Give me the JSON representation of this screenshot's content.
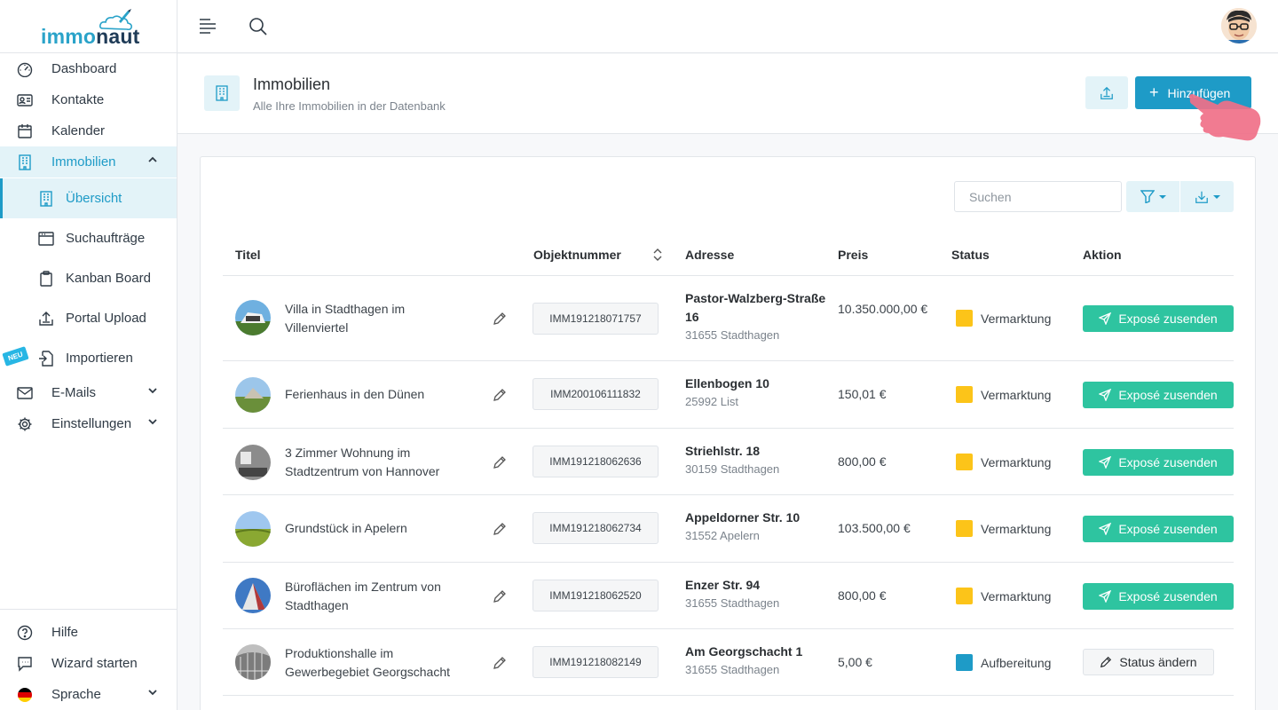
{
  "logo": {
    "part1": "immo",
    "part2": "naut"
  },
  "sidebar": {
    "items": [
      {
        "label": "Dashboard"
      },
      {
        "label": "Kontakte"
      },
      {
        "label": "Kalender"
      },
      {
        "label": "Immobilien"
      },
      {
        "label": "Übersicht"
      },
      {
        "label": "Suchaufträge"
      },
      {
        "label": "Kanban Board"
      },
      {
        "label": "Portal Upload"
      },
      {
        "label": "Importieren"
      },
      {
        "label": "E-Mails"
      },
      {
        "label": "Einstellungen"
      }
    ],
    "badge": "NEU",
    "bottom": [
      {
        "label": "Hilfe"
      },
      {
        "label": "Wizard starten"
      },
      {
        "label": "Sprache"
      }
    ]
  },
  "header": {
    "title": "Immobilien",
    "subtitle": "Alle Ihre Immobilien in der Datenbank",
    "add_label": "Hinzufügen"
  },
  "toolbar": {
    "search_placeholder": "Suchen"
  },
  "table": {
    "columns": [
      "Titel",
      "Objektnummer",
      "Adresse",
      "Preis",
      "Status",
      "Aktion"
    ],
    "rows": [
      {
        "title": "Villa in Stadthagen im Villenviertel",
        "objnr": "IMM191218071757",
        "street": "Pastor-Walzberg-Straße 16",
        "city": "31655 Stadthagen",
        "price": "10.350.000,00 €",
        "status": "Vermarktung",
        "action": "Exposé zusenden"
      },
      {
        "title": "Ferienhaus in den Dünen",
        "objnr": "IMM200106111832",
        "street": "Ellenbogen 10",
        "city": "25992 List",
        "price": "150,01 €",
        "status": "Vermarktung",
        "action": "Exposé zusenden"
      },
      {
        "title": "3 Zimmer Wohnung im Stadtzentrum von Hannover",
        "objnr": "IMM191218062636",
        "street": "Striehlstr. 18",
        "city": "30159 Stadthagen",
        "price": "800,00 €",
        "status": "Vermarktung",
        "action": "Exposé zusenden"
      },
      {
        "title": "Grundstück in Apelern",
        "objnr": "IMM191218062734",
        "street": "Appeldorner Str. 10",
        "city": "31552 Apelern",
        "price": "103.500,00 €",
        "status": "Vermarktung",
        "action": "Exposé zusenden"
      },
      {
        "title": "Büroflächen im Zentrum von Stadthagen",
        "objnr": "IMM191218062520",
        "street": "Enzer Str. 94",
        "city": "31655 Stadthagen",
        "price": "800,00 €",
        "status": "Vermarktung",
        "action": "Exposé zusenden"
      },
      {
        "title": "Produktionshalle im Gewerbegebiet Georgschacht",
        "objnr": "IMM191218082149",
        "street": "Am Georgschacht 1",
        "city": "31655 Stadthagen",
        "price": "5,00 €",
        "status": "Aufbereitung",
        "action": "Status ändern"
      }
    ]
  },
  "colors": {
    "accent": "#1e9bc7",
    "success": "#2ec4a0",
    "status_vermarktung": "#fcc419",
    "status_aufbereitung": "#1e9bc7"
  }
}
